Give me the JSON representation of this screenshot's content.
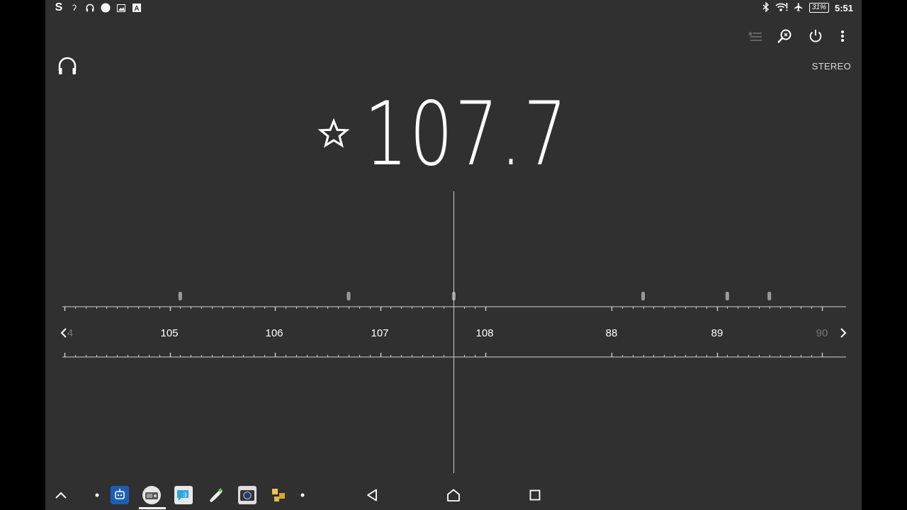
{
  "status_bar": {
    "left_icons": [
      "s-app-icon",
      "hook-icon",
      "headphones-icon",
      "circle-icon",
      "image-icon",
      "font-a-icon"
    ],
    "battery": "31%",
    "time": "5:51"
  },
  "actions": {
    "favorites_list": "favorites-list-icon",
    "search": "search-stations-icon",
    "power": "power-icon",
    "menu": "more-vert-icon"
  },
  "audio_mode": "STEREO",
  "frequency": "107.7",
  "dial": {
    "labels": [
      "105",
      "106",
      "107",
      "108",
      "88",
      "89"
    ],
    "faded_right_label": "90",
    "faded_left_label": "4",
    "current_frequency_mhz": 107.7,
    "preset_frequencies_mhz": [
      105.1,
      106.7,
      107.7,
      88.3,
      89.1,
      89.5
    ]
  },
  "colors": {
    "background": "#303030",
    "side_bars": "#000000",
    "text": "#ffffff",
    "dim_text": "#7a7a7a"
  }
}
